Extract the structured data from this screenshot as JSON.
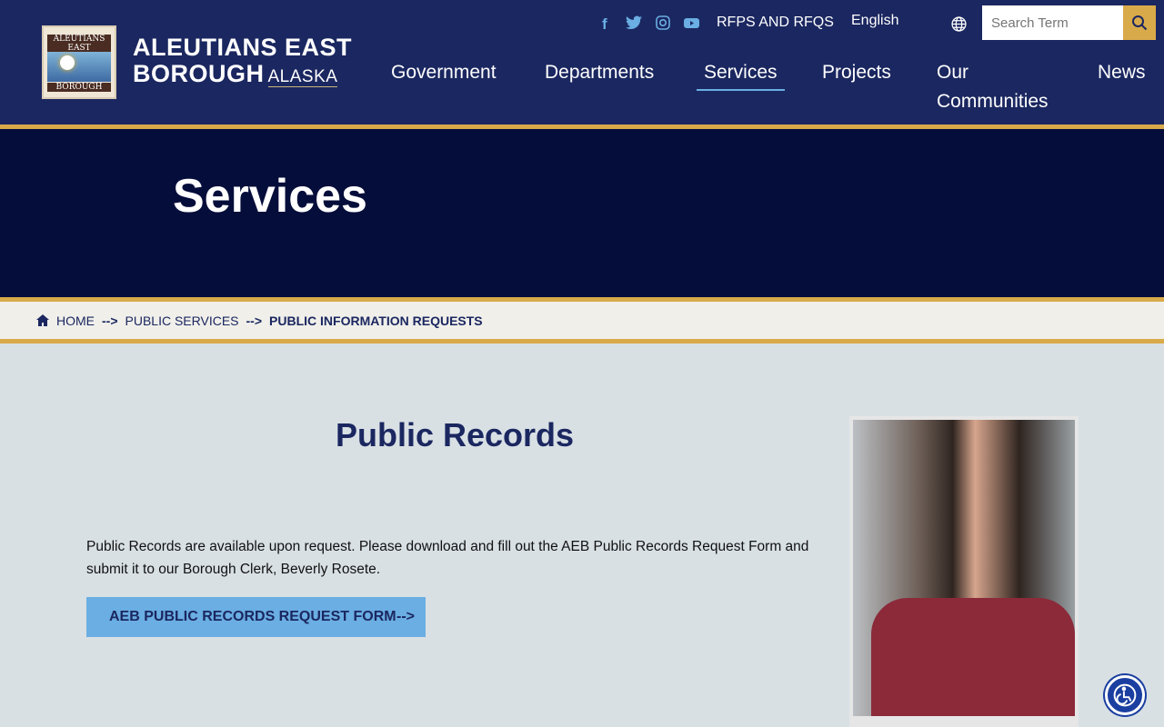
{
  "header": {
    "logo_badge_top": "ALEUTIANS EAST",
    "logo_badge_bottom": "BOROUGH",
    "logo_line1": "ALEUTIANS EAST",
    "logo_line2": "BOROUGH",
    "logo_state": "ALASKA",
    "rfps_link": "RFPS AND RFQS",
    "language": "English",
    "search_placeholder": "Search Term"
  },
  "nav": [
    "Government",
    "Departments",
    "Services",
    "Projects",
    "Our Communities",
    "News"
  ],
  "hero": {
    "title": "Services"
  },
  "breadcrumb": {
    "home": "HOME",
    "sep": "-->",
    "level1": "PUBLIC SERVICES",
    "current": "PUBLIC INFORMATION REQUESTS"
  },
  "main": {
    "heading": "Public Records",
    "paragraph": "Public Records are available upon request. Please download and fill out the AEB Public Records Request Form and submit it to our Borough Clerk, Beverly Rosete.",
    "button_label": "AEB PUBLIC RECORDS REQUEST FORM",
    "button_arrow": "-->"
  }
}
